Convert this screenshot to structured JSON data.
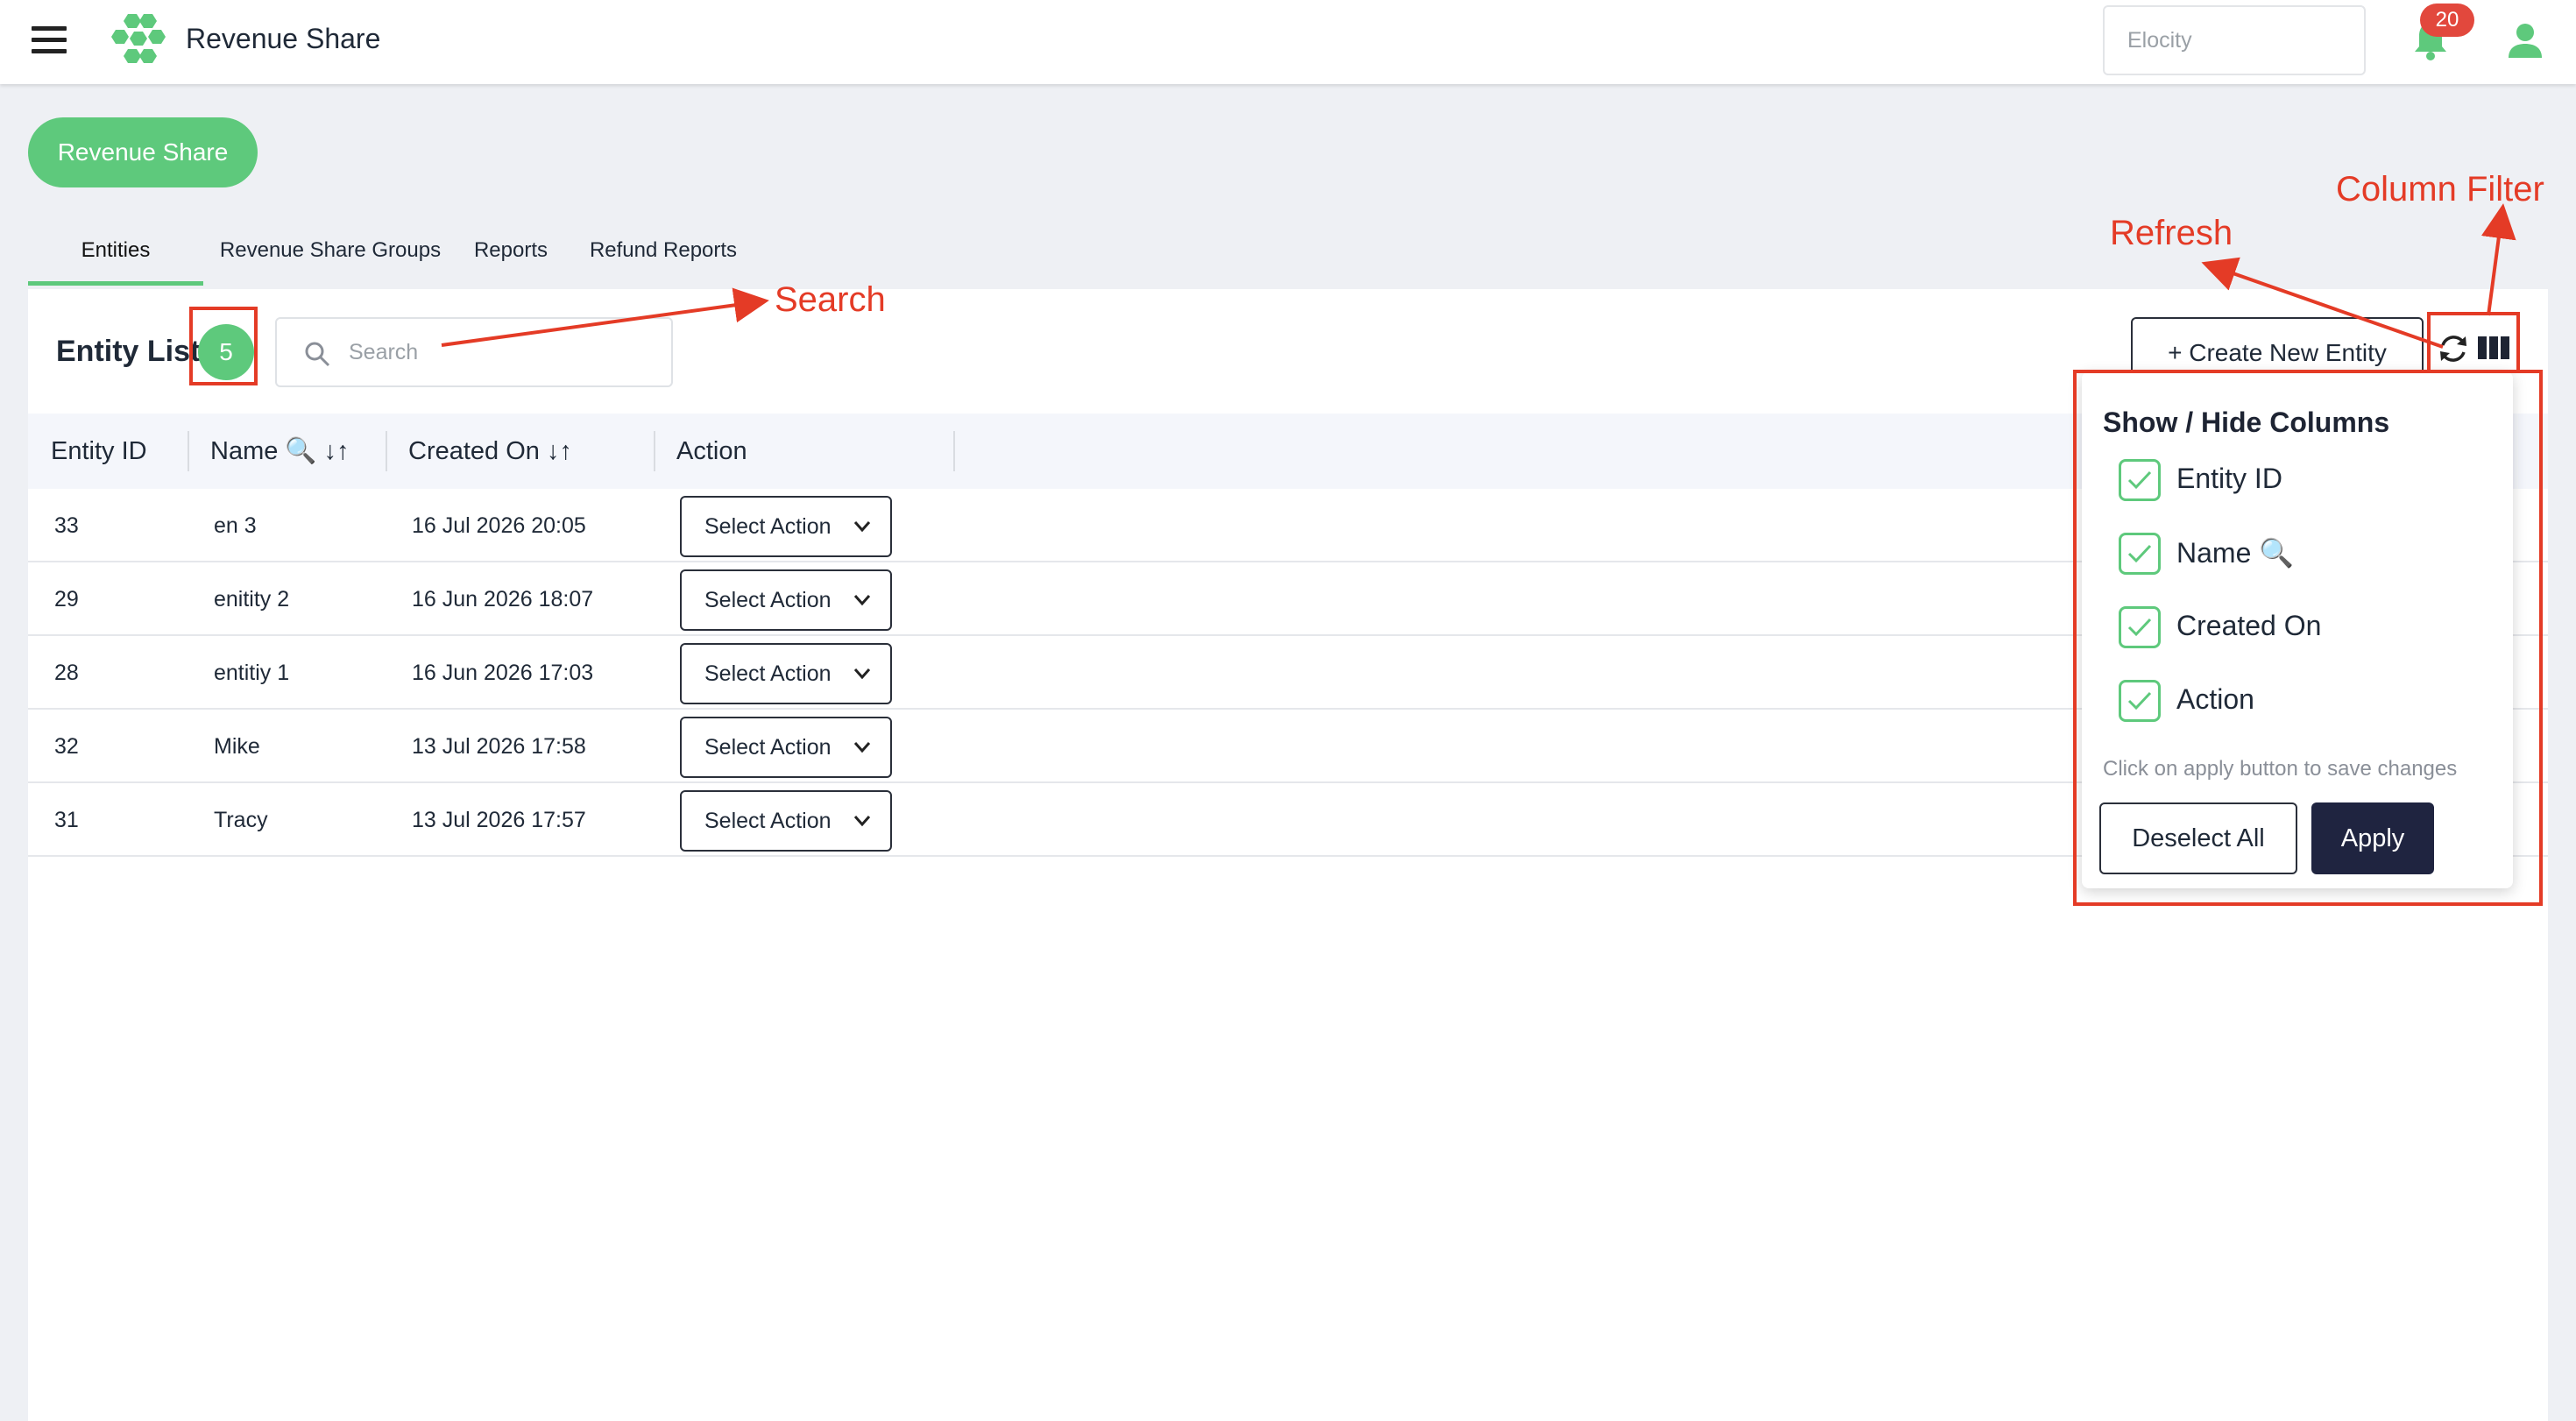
{
  "header": {
    "app_title": "Revenue Share",
    "org_placeholder": "Elocity",
    "notification_count": "20"
  },
  "page": {
    "title_pill": "Revenue Share"
  },
  "tabs": [
    {
      "label": "Entities",
      "active": true
    },
    {
      "label": "Revenue Share Groups",
      "active": false
    },
    {
      "label": "Reports",
      "active": false
    },
    {
      "label": "Refund Reports",
      "active": false
    }
  ],
  "entity_list": {
    "title": "Entity List",
    "count": "5",
    "search_placeholder": "Search",
    "create_button": "+ Create New Entity"
  },
  "table": {
    "columns": [
      "Entity ID",
      "Name 🔍 ↓↑",
      "Created On ↓↑",
      "Action"
    ],
    "rows": [
      {
        "id": "33",
        "name": "en 3",
        "created": "16 Jul 2026 20:05",
        "action": "Select Action"
      },
      {
        "id": "29",
        "name": "enitity 2",
        "created": "16 Jun 2026 18:07",
        "action": "Select Action"
      },
      {
        "id": "28",
        "name": "entitiy 1",
        "created": "16 Jun 2026 17:03",
        "action": "Select Action"
      },
      {
        "id": "32",
        "name": "Mike",
        "created": "13 Jul 2026 17:58",
        "action": "Select Action"
      },
      {
        "id": "31",
        "name": "Tracy",
        "created": "13 Jul 2026 17:57",
        "action": "Select Action"
      }
    ]
  },
  "column_filter": {
    "title": "Show / Hide Columns",
    "items": [
      {
        "label": "Entity ID",
        "checked": true
      },
      {
        "label": "Name 🔍",
        "checked": true
      },
      {
        "label": "Created On",
        "checked": true
      },
      {
        "label": "Action",
        "checked": true
      }
    ],
    "note": "Click on apply button to save changes",
    "deselect_button": "Deselect All",
    "apply_button": "Apply"
  },
  "annotations": {
    "search": "Search",
    "refresh": "Refresh",
    "column_filter": "Column Filter"
  },
  "colors": {
    "accent_green": "#5ec97c",
    "annotation_red": "#e43b26",
    "primary_dark": "#1f2440",
    "badge_red": "#e2483d"
  }
}
